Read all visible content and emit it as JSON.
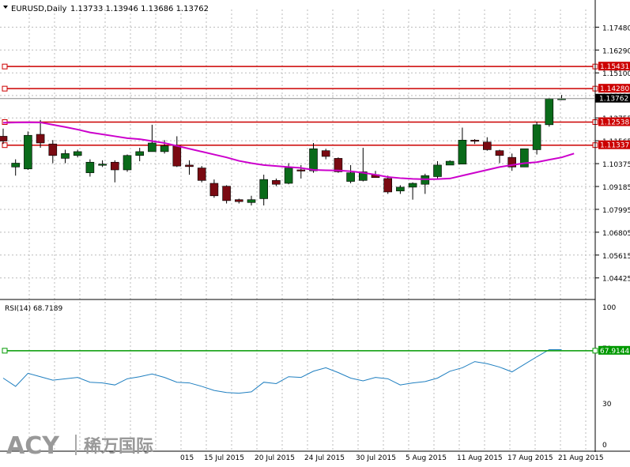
{
  "chart_data": [
    {
      "type": "candlestick",
      "title": "EURUSD,Daily  1.13733 1.13946 1.13686 1.13762",
      "symbol_label": "EURUSD,Daily",
      "ohlc_label": "1.13733 1.13946 1.13686 1.13762",
      "ylim": [
        1.0355,
        1.184
      ],
      "y_tick_labels": [
        "1.17480",
        "1.16290",
        "1.15100",
        "1.13920",
        "1.12755",
        "1.11565",
        "1.10375",
        "1.09185",
        "1.07995",
        "1.06805",
        "1.05615",
        "1.04425"
      ],
      "x_tick_labels": [
        "015",
        "15 Jul 2015",
        "20 Jul 2015",
        "24 Jul 2015",
        "30 Jul 2015",
        "5 Aug 2015",
        "11 Aug 2015",
        "17 Aug 2015",
        "21 Aug 2015"
      ],
      "horizontal_levels": [
        {
          "value": 1.15431,
          "label": "1.15431",
          "color": "#cc0000"
        },
        {
          "value": 1.1428,
          "label": "1.14280",
          "color": "#cc0000"
        },
        {
          "value": 1.12538,
          "label": "1.12538",
          "color": "#cc0000"
        },
        {
          "value": 1.11337,
          "label": "1.11337",
          "color": "#cc0000"
        }
      ],
      "current_price": {
        "value": 1.13762,
        "label": "1.13762"
      },
      "candles": [
        {
          "o": 1.118,
          "h": 1.122,
          "l": 1.114,
          "c": 1.1155
        },
        {
          "o": 1.102,
          "h": 1.106,
          "l": 1.0975,
          "c": 1.104
        },
        {
          "o": 1.101,
          "h": 1.1205,
          "l": 1.1005,
          "c": 1.1185
        },
        {
          "o": 1.119,
          "h": 1.1265,
          "l": 1.112,
          "c": 1.1145
        },
        {
          "o": 1.114,
          "h": 1.116,
          "l": 1.104,
          "c": 1.108
        },
        {
          "o": 1.1065,
          "h": 1.111,
          "l": 1.104,
          "c": 1.109
        },
        {
          "o": 1.108,
          "h": 1.111,
          "l": 1.107,
          "c": 1.11
        },
        {
          "o": 1.099,
          "h": 1.106,
          "l": 1.097,
          "c": 1.1045
        },
        {
          "o": 1.103,
          "h": 1.1055,
          "l": 1.102,
          "c": 1.1035
        },
        {
          "o": 1.1045,
          "h": 1.1055,
          "l": 1.094,
          "c": 1.1005
        },
        {
          "o": 1.1005,
          "h": 1.1085,
          "l": 1.0995,
          "c": 1.108
        },
        {
          "o": 1.108,
          "h": 1.112,
          "l": 1.105,
          "c": 1.11
        },
        {
          "o": 1.11,
          "h": 1.124,
          "l": 1.11,
          "c": 1.1145
        },
        {
          "o": 1.11,
          "h": 1.116,
          "l": 1.109,
          "c": 1.113
        },
        {
          "o": 1.113,
          "h": 1.118,
          "l": 1.102,
          "c": 1.1025
        },
        {
          "o": 1.103,
          "h": 1.1055,
          "l": 1.098,
          "c": 1.1022
        },
        {
          "o": 1.1015,
          "h": 1.1025,
          "l": 1.094,
          "c": 1.095
        },
        {
          "o": 1.0935,
          "h": 1.0955,
          "l": 1.086,
          "c": 1.087
        },
        {
          "o": 1.092,
          "h": 1.0925,
          "l": 1.083,
          "c": 1.0845
        },
        {
          "o": 1.085,
          "h": 1.0855,
          "l": 1.083,
          "c": 1.084
        },
        {
          "o": 1.0835,
          "h": 1.087,
          "l": 1.082,
          "c": 1.085
        },
        {
          "o": 1.0855,
          "h": 1.098,
          "l": 1.082,
          "c": 1.0955
        },
        {
          "o": 1.095,
          "h": 1.096,
          "l": 1.092,
          "c": 1.093
        },
        {
          "o": 1.0935,
          "h": 1.104,
          "l": 1.093,
          "c": 1.1015
        },
        {
          "o": 1.1005,
          "h": 1.103,
          "l": 1.096,
          "c": 1.1
        },
        {
          "o": 1.1,
          "h": 1.1145,
          "l": 1.099,
          "c": 1.1115
        },
        {
          "o": 1.1105,
          "h": 1.1115,
          "l": 1.106,
          "c": 1.1075
        },
        {
          "o": 1.1065,
          "h": 1.107,
          "l": 1.099,
          "c": 1.0995
        },
        {
          "o": 1.0945,
          "h": 1.103,
          "l": 1.0935,
          "c": 1.099
        },
        {
          "o": 1.095,
          "h": 1.112,
          "l": 1.0945,
          "c": 1.0995
        },
        {
          "o": 1.098,
          "h": 1.1,
          "l": 1.0965,
          "c": 1.0965
        },
        {
          "o": 1.096,
          "h": 1.0975,
          "l": 1.088,
          "c": 1.089
        },
        {
          "o": 1.0895,
          "h": 1.0925,
          "l": 1.088,
          "c": 1.0915
        },
        {
          "o": 1.0915,
          "h": 1.094,
          "l": 1.085,
          "c": 1.0935
        },
        {
          "o": 1.093,
          "h": 1.0985,
          "l": 1.088,
          "c": 1.0975
        },
        {
          "o": 1.097,
          "h": 1.105,
          "l": 1.096,
          "c": 1.103
        },
        {
          "o": 1.103,
          "h": 1.1055,
          "l": 1.103,
          "c": 1.105
        },
        {
          "o": 1.1035,
          "h": 1.1225,
          "l": 1.1035,
          "c": 1.116
        },
        {
          "o": 1.116,
          "h": 1.1165,
          "l": 1.114,
          "c": 1.1155
        },
        {
          "o": 1.115,
          "h": 1.1175,
          "l": 1.1105,
          "c": 1.111
        },
        {
          "o": 1.1105,
          "h": 1.111,
          "l": 1.104,
          "c": 1.108
        },
        {
          "o": 1.107,
          "h": 1.109,
          "l": 1.1,
          "c": 1.102
        },
        {
          "o": 1.102,
          "h": 1.1105,
          "l": 1.102,
          "c": 1.1115
        },
        {
          "o": 1.111,
          "h": 1.1255,
          "l": 1.1085,
          "c": 1.124
        },
        {
          "o": 1.124,
          "h": 1.138,
          "l": 1.123,
          "c": 1.1375
        },
        {
          "o": 1.13733,
          "h": 1.13946,
          "l": 1.13686,
          "c": 1.13762
        }
      ],
      "moving_average": {
        "color": "#cc00cc",
        "values": [
          1.125,
          1.1252,
          1.1253,
          1.1252,
          1.124,
          1.1228,
          1.1215,
          1.12,
          1.119,
          1.118,
          1.117,
          1.1165,
          1.1155,
          1.1145,
          1.113,
          1.1115,
          1.11,
          1.1085,
          1.107,
          1.1052,
          1.104,
          1.103,
          1.1025,
          1.102,
          1.1015,
          1.1005,
          1.1003,
          1.1002,
          1.0998,
          1.099,
          1.098,
          1.0968,
          1.0962,
          1.0958,
          1.0956,
          1.0957,
          1.096,
          1.0975,
          1.099,
          1.1005,
          1.102,
          1.103,
          1.104,
          1.1045,
          1.1058,
          1.107,
          1.109
        ]
      }
    },
    {
      "type": "line",
      "title": "RSI(14) 68.7189",
      "label": "RSI(14) 68.7189",
      "ylim": [
        0,
        100
      ],
      "y_tick_labels": [
        "100",
        "70",
        "30",
        "0"
      ],
      "level": {
        "value": 67.9144,
        "label": "67.9144",
        "color": "#009900"
      },
      "series": [
        {
          "values": [
            48.0,
            42.0,
            51.5,
            49.0,
            46.5,
            47.5,
            48.5,
            45.0,
            44.5,
            43.0,
            47.5,
            49.0,
            51.0,
            48.5,
            45.0,
            44.5,
            42.0,
            39.0,
            37.5,
            37.0,
            38.0,
            45.0,
            44.0,
            49.0,
            48.5,
            53.0,
            55.5,
            52.0,
            48.0,
            46.0,
            48.5,
            47.5,
            43.0,
            44.5,
            45.5,
            48.0,
            53.0,
            55.5,
            60.0,
            58.5,
            56.0,
            52.5,
            58.0,
            63.5,
            68.7,
            68.7
          ],
          "color": "#1f7fc0"
        }
      ]
    }
  ],
  "logo": {
    "brand": "ACY",
    "chinese": "稀万国际"
  }
}
